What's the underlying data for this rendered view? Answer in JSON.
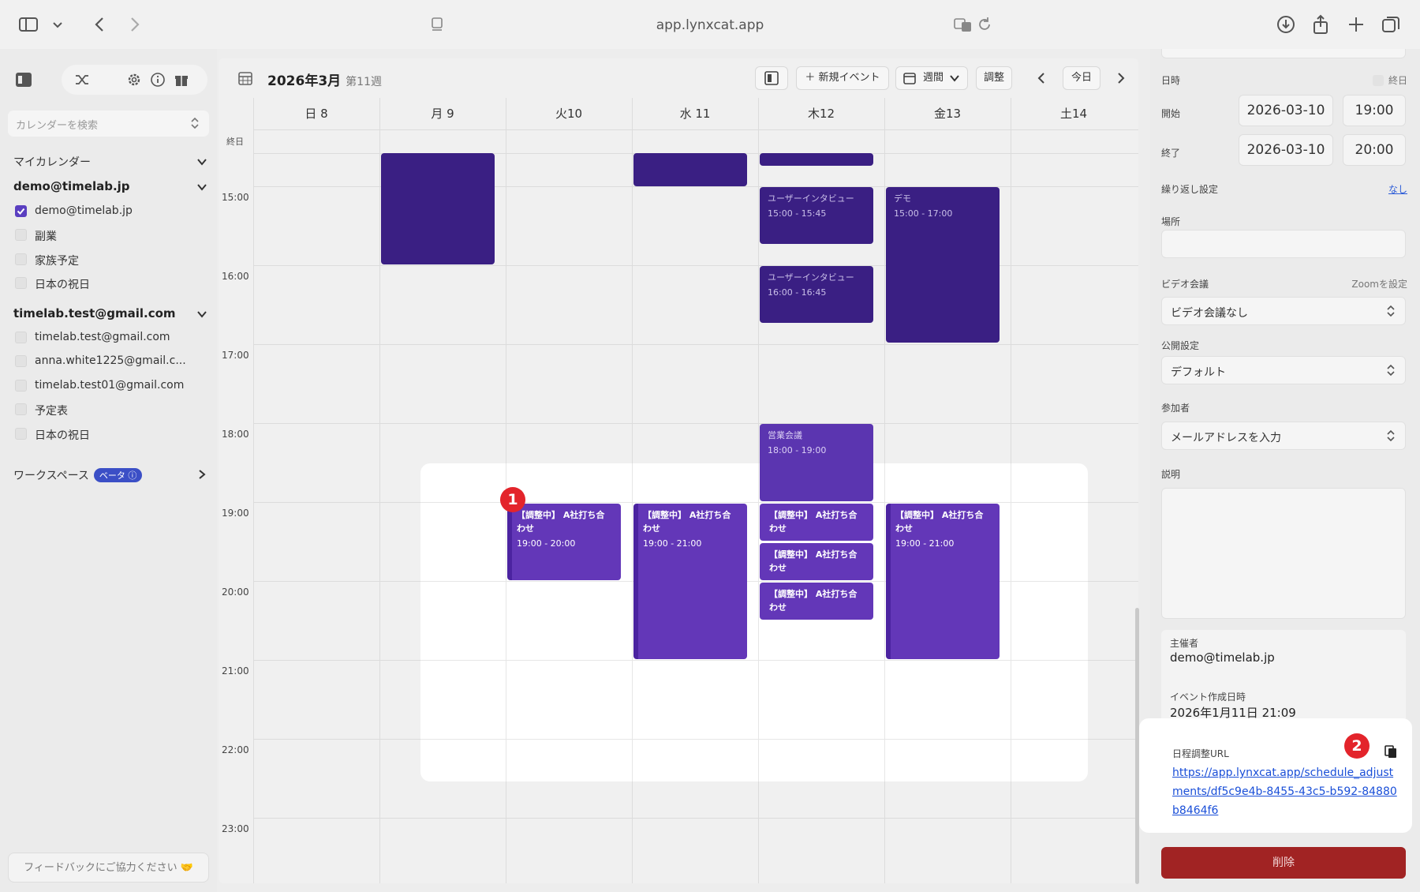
{
  "browser": {
    "url": "app.lynxcat.app"
  },
  "sidebar": {
    "search_placeholder": "カレンダーを検索",
    "my_calendars": "マイカレンダー",
    "accounts": [
      {
        "email": "demo@timelab.jp",
        "calendars": [
          {
            "label": "demo@timelab.jp",
            "checked": true
          },
          {
            "label": "副業",
            "checked": false
          },
          {
            "label": "家族予定",
            "checked": false
          },
          {
            "label": "日本の祝日",
            "checked": false
          }
        ]
      },
      {
        "email": "timelab.test@gmail.com",
        "calendars": [
          {
            "label": "timelab.test@gmail.com",
            "checked": false
          },
          {
            "label": "anna.white1225@gmail.c...",
            "checked": false
          },
          {
            "label": "timelab.test01@gmail.com",
            "checked": false
          },
          {
            "label": "予定表",
            "checked": false
          },
          {
            "label": "日本の祝日",
            "checked": false
          }
        ]
      }
    ],
    "workspace": "ワークスペース",
    "beta": "ベータ",
    "feedback": "フィードバックにご協力ください 🤝"
  },
  "calendar": {
    "title": "2026年3月",
    "week": "第11週",
    "new_event": "＋ 新規イベント",
    "view": "週間",
    "adjust": "調整",
    "today": "今日",
    "all_day": "終日",
    "days": [
      "日 8",
      "月 9",
      "火10",
      "水 11",
      "木12",
      "金13",
      "土14"
    ],
    "hours": [
      "15:00",
      "16:00",
      "17:00",
      "18:00",
      "19:00",
      "20:00",
      "21:00",
      "22:00",
      "23:00"
    ],
    "events": {
      "interview1_title": "ユーザーインタビュー",
      "interview1_time": "15:00 - 15:45",
      "interview2_title": "ユーザーインタビュー",
      "interview2_time": "16:00 - 16:45",
      "demo_title": "デモ",
      "demo_time": "15:00 - 17:00",
      "sales_title": "営業会議",
      "sales_time": "18:00 - 19:00",
      "adj_title": "【調整中】 A社打ち合わせ",
      "adj_time_mon": "19:00 - 20:00",
      "adj_time_wed": "19:00 - 21:00",
      "adj_time_fri": "19:00 - 21:00"
    }
  },
  "badges": {
    "one": "1",
    "two": "2"
  },
  "panel": {
    "datetime": "日時",
    "allday": "終日",
    "start": "開始",
    "start_date": "2026-03-10",
    "start_time": "19:00",
    "end": "終了",
    "end_date": "2026-03-10",
    "end_time": "20:00",
    "repeat": "繰り返し設定",
    "repeat_value": "なし",
    "location": "場所",
    "video": "ビデオ会議",
    "zoom": "Zoomを設定",
    "video_value": "ビデオ会議なし",
    "visibility": "公開設定",
    "visibility_value": "デフォルト",
    "attendees": "参加者",
    "attendees_placeholder": "メールアドレスを入力",
    "description": "説明",
    "organizer": "主催者",
    "organizer_value": "demo@timelab.jp",
    "created": "イベント作成日時",
    "created_value": "2026年1月11日 21:09",
    "url_label": "日程調整URL",
    "url_value": "https://app.lynxcat.app/schedule_adjustments/df5c9e4b-8455-43c5-b592-84880b8464f6",
    "delete": "削除"
  }
}
